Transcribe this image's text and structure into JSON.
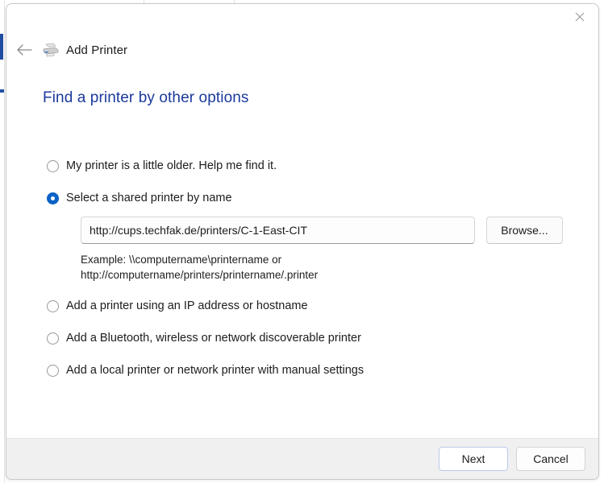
{
  "window": {
    "app_title": "Add Printer",
    "printer_icon": "printer-icon",
    "back_icon": "back-arrow-icon",
    "close_icon": "close-icon",
    "accent_color": "#1b3a9c",
    "selected_radio_color": "#0b62c7"
  },
  "page": {
    "heading": "Find a printer by other options"
  },
  "options": [
    {
      "id": "older-printer",
      "label": "My printer is a little older. Help me find it.",
      "selected": false
    },
    {
      "id": "shared-by-name",
      "label": "Select a shared printer by name",
      "selected": true
    },
    {
      "id": "ip-or-hostname",
      "label": "Add a printer using an IP address or hostname",
      "selected": false
    },
    {
      "id": "bluetooth",
      "label": "Add a Bluetooth, wireless or network discoverable printer",
      "selected": false
    },
    {
      "id": "local-manual",
      "label": "Add a local printer or network printer with manual settings",
      "selected": false
    }
  ],
  "shared_printer": {
    "input_value": "http://cups.techfak.de/printers/C-1-East-CIT",
    "input_placeholder": "",
    "browse_label": "Browse...",
    "example_line1": "Example: \\\\computername\\printername or",
    "example_line2": "http://computername/printers/printername/.printer"
  },
  "footer": {
    "next_label": "Next",
    "cancel_label": "Cancel"
  }
}
